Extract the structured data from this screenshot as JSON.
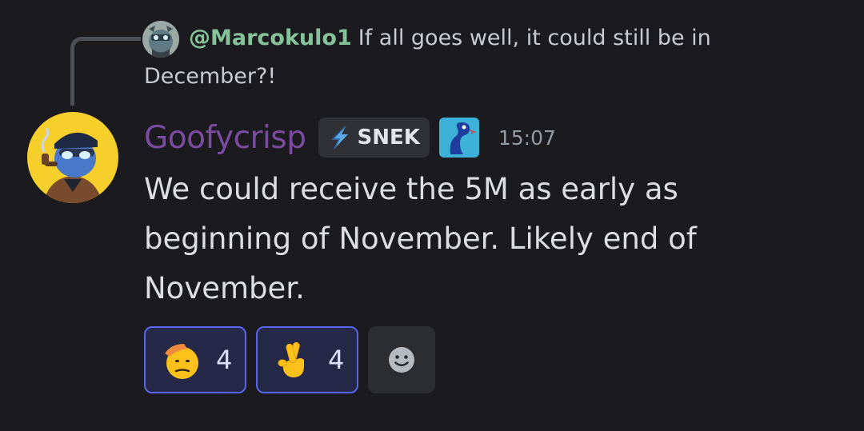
{
  "reply": {
    "mention": "@Marcokulo1",
    "text_line1": "If all goes well, it could still be in",
    "text_line2": "December?!"
  },
  "message": {
    "username": "Goofycrisp",
    "tag_label": "SNEK",
    "timestamp": "15:07",
    "text": "We could receive the 5M as early as beginning of November. Likely end of November."
  },
  "reactions": [
    {
      "emoji": "saluting-face",
      "count": "4"
    },
    {
      "emoji": "crossed-fingers",
      "count": "4"
    }
  ],
  "colors": {
    "background": "#1b1b1f",
    "mention": "#86c39b",
    "username": "#7a4ba0",
    "reaction_border": "#5865f2",
    "reaction_bg": "#252947",
    "timestamp": "#949ba4"
  }
}
